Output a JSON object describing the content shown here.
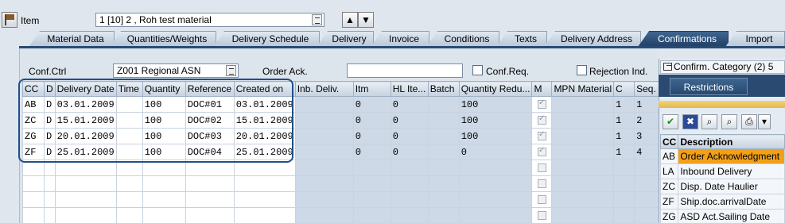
{
  "header": {
    "item_label": "Item",
    "item_value": "1 [10] 2 , Roh test material"
  },
  "tabs": [
    {
      "label": "Material Data",
      "active": false
    },
    {
      "label": "Quantities/Weights",
      "active": false
    },
    {
      "label": "Delivery Schedule",
      "active": false
    },
    {
      "label": "Delivery",
      "active": false
    },
    {
      "label": "Invoice",
      "active": false
    },
    {
      "label": "Conditions",
      "active": false
    },
    {
      "label": "Texts",
      "active": false
    },
    {
      "label": "Delivery Address",
      "active": false
    },
    {
      "label": "Confirmations",
      "active": true
    },
    {
      "label": "Import",
      "active": false
    }
  ],
  "form": {
    "conf_ctrl_label": "Conf.Ctrl",
    "conf_ctrl_value": "Z001 Regional ASN",
    "order_ack_label": "Order Ack.",
    "order_ack_value": "",
    "conf_req_label": "Conf.Req.",
    "rejection_label": "Rejection Ind."
  },
  "table": {
    "columns": [
      "CC",
      "D",
      "Delivery Date",
      "Time",
      "Quantity",
      "Reference",
      "Created on",
      "Inb. Deliv.",
      "Itm",
      "HL Ite...",
      "Batch",
      "Quantity Redu...",
      "M",
      "MPN Material",
      "C",
      "Seq."
    ],
    "rows": [
      {
        "cc": "AB",
        "d": "D",
        "date": "03.01.2009",
        "time": "",
        "qty": "100",
        "ref": "DOC#01",
        "created": "03.01.2009",
        "inb": "",
        "itm": "0",
        "hl": "0",
        "batch": "",
        "qred": "100",
        "m": true,
        "mpn": "",
        "c": "1",
        "seq": "1"
      },
      {
        "cc": "ZC",
        "d": "D",
        "date": "15.01.2009",
        "time": "",
        "qty": "100",
        "ref": "DOC#02",
        "created": "15.01.2009",
        "inb": "",
        "itm": "0",
        "hl": "0",
        "batch": "",
        "qred": "100",
        "m": true,
        "mpn": "",
        "c": "1",
        "seq": "2"
      },
      {
        "cc": "ZG",
        "d": "D",
        "date": "20.01.2009",
        "time": "",
        "qty": "100",
        "ref": "DOC#03",
        "created": "20.01.2009",
        "inb": "",
        "itm": "0",
        "hl": "0",
        "batch": "",
        "qred": "100",
        "m": true,
        "mpn": "",
        "c": "1",
        "seq": "3"
      },
      {
        "cc": "ZF",
        "d": "D",
        "date": "25.01.2009",
        "time": "",
        "qty": "100",
        "ref": "DOC#04",
        "created": "25.01.2009",
        "inb": "",
        "itm": "0",
        "hl": "0",
        "batch": "",
        "qred": "0",
        "m": true,
        "mpn": "",
        "c": "1",
        "seq": "4"
      },
      {
        "cc": "",
        "d": "",
        "date": "",
        "time": "",
        "qty": "",
        "ref": "",
        "created": "",
        "inb": "",
        "itm": "",
        "hl": "",
        "batch": "",
        "qred": "",
        "m": false,
        "mpn": "",
        "c": "",
        "seq": ""
      },
      {
        "cc": "",
        "d": "",
        "date": "",
        "time": "",
        "qty": "",
        "ref": "",
        "created": "",
        "inb": "",
        "itm": "",
        "hl": "",
        "batch": "",
        "qred": "",
        "m": false,
        "mpn": "",
        "c": "",
        "seq": ""
      },
      {
        "cc": "",
        "d": "",
        "date": "",
        "time": "",
        "qty": "",
        "ref": "",
        "created": "",
        "inb": "",
        "itm": "",
        "hl": "",
        "batch": "",
        "qred": "",
        "m": false,
        "mpn": "",
        "c": "",
        "seq": ""
      },
      {
        "cc": "",
        "d": "",
        "date": "",
        "time": "",
        "qty": "",
        "ref": "",
        "created": "",
        "inb": "",
        "itm": "",
        "hl": "",
        "batch": "",
        "qred": "",
        "m": false,
        "mpn": "",
        "c": "",
        "seq": ""
      }
    ]
  },
  "popup": {
    "title": "Confirm. Category (2)  5",
    "restrictions_tab": "Restrictions",
    "list_headers": [
      "CC",
      "Description"
    ],
    "items": [
      {
        "code": "AB",
        "desc": "Order Acknowledgment",
        "selected": true
      },
      {
        "code": "LA",
        "desc": "Inbound Delivery",
        "selected": false
      },
      {
        "code": "ZC",
        "desc": "Disp. Date Haulier",
        "selected": false
      },
      {
        "code": "ZF",
        "desc": "Ship.doc.arrivalDate",
        "selected": false
      },
      {
        "code": "ZG",
        "desc": "ASD Act.Sailing Date",
        "selected": false
      }
    ]
  },
  "colors": {
    "active_tab": "#1f3f66",
    "highlight": "#1f4e8c",
    "selected_row": "#f2a018"
  }
}
